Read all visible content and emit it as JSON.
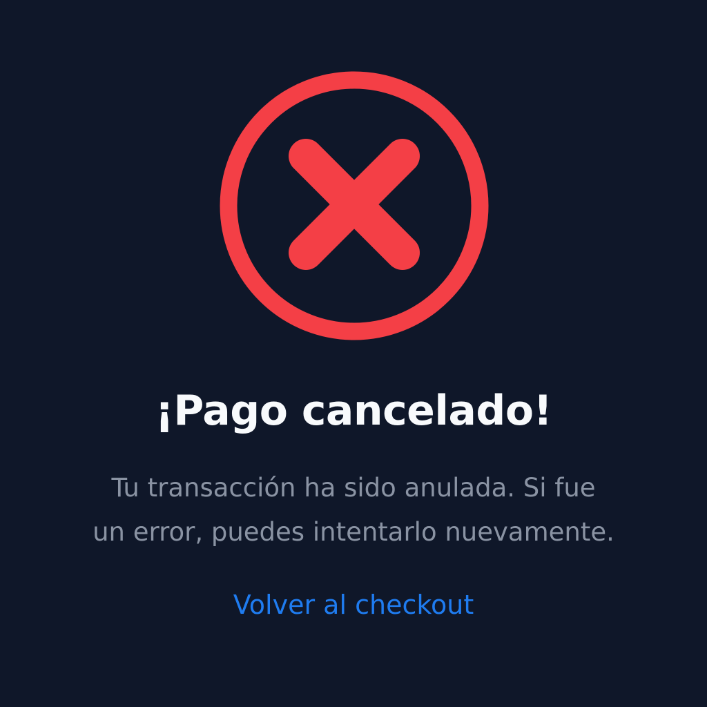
{
  "status": {
    "icon": "cancel-x-circle-icon",
    "color": "#f43f46"
  },
  "title": "¡Pago cancelado!",
  "message": {
    "line1": "Tu transacción ha sido anulada. Si fue",
    "line2": "un error, puedes intentarlo nuevamente."
  },
  "link": {
    "label": "Volver al checkout",
    "color": "#1f7cf0"
  },
  "colors": {
    "background": "#0f1729",
    "title": "#f8fafc",
    "message": "#8a93a3"
  }
}
